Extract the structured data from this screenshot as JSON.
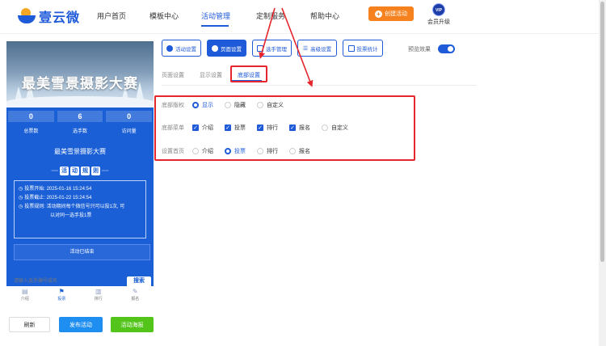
{
  "brand": {
    "name": "壹云微"
  },
  "nav": {
    "items": [
      "用户首页",
      "模板中心",
      "活动管理",
      "定制服务",
      "帮助中心"
    ],
    "active": "活动管理",
    "create_label": "创建活动",
    "vip_badge": "VIP",
    "vip_label": "会员升级"
  },
  "preview": {
    "banner_title": "最美雪景摄影大赛",
    "stats": [
      {
        "value": "0",
        "label": "总票数"
      },
      {
        "value": "6",
        "label": "选手数"
      },
      {
        "value": "0",
        "label": "访问量"
      }
    ],
    "activity_name": "最美雪景摄影大赛",
    "rules_title": [
      "活",
      "动",
      "规",
      "则"
    ],
    "rules": {
      "start": "投票开始: 2025-01-16 15:24:54",
      "end": "投票截止: 2025-01-22 15:24:54",
      "rule_line1": "投票规则: 活动期间每个微信号只可以投1次, 可",
      "rule_line2": "以对同一选手投1票"
    },
    "status": "活动已结束",
    "search_placeholder": "请输入选手编号或名",
    "search_button": "搜索",
    "tabs": [
      {
        "icon": "▤",
        "label": "介绍"
      },
      {
        "icon": "⚑",
        "label": "投票"
      },
      {
        "icon": "▥",
        "label": "排行"
      },
      {
        "icon": "✎",
        "label": "报名"
      }
    ],
    "active_tab": "投票"
  },
  "bottom_buttons": {
    "refresh": "刷新",
    "publish": "发布活动",
    "poster": "活动海报"
  },
  "settings_tabs": [
    {
      "label": "活动设置",
      "icon": "gear-icon"
    },
    {
      "label": "页面设置",
      "icon": "gear-icon"
    },
    {
      "label": "选手管理",
      "icon": "user-icon"
    },
    {
      "label": "高级设置",
      "icon": "sliders-icon"
    },
    {
      "label": "投票统计",
      "icon": "bar-chart-icon"
    }
  ],
  "active_settings_tab": "页面设置",
  "preview_toggle": {
    "label": "预览效果",
    "on": true
  },
  "subtabs": [
    "页面设置",
    "显示设置",
    "底部设置"
  ],
  "active_subtab": "底部设置",
  "form": {
    "copyright": {
      "label": "底部版权",
      "options": [
        {
          "label": "显示",
          "selected": true
        },
        {
          "label": "隐藏",
          "selected": false
        },
        {
          "label": "自定义",
          "selected": false
        }
      ]
    },
    "bottom_menu": {
      "label": "底部菜单",
      "options": [
        {
          "label": "介绍",
          "checked": true
        },
        {
          "label": "投票",
          "checked": true
        },
        {
          "label": "排行",
          "checked": true
        },
        {
          "label": "报名",
          "checked": true
        },
        {
          "label": "自定义",
          "checked": false
        }
      ]
    },
    "home_page": {
      "label": "设置首页",
      "options": [
        {
          "label": "介绍",
          "selected": false
        },
        {
          "label": "投票",
          "selected": true
        },
        {
          "label": "排行",
          "selected": false
        },
        {
          "label": "报名",
          "selected": false
        }
      ]
    }
  },
  "colors": {
    "primary": "#1f5bd8",
    "preview_bg": "#1a5fd6",
    "create_orange": "#f5821f",
    "poster_green": "#52c41a",
    "annotation_red": "#e5262d"
  }
}
